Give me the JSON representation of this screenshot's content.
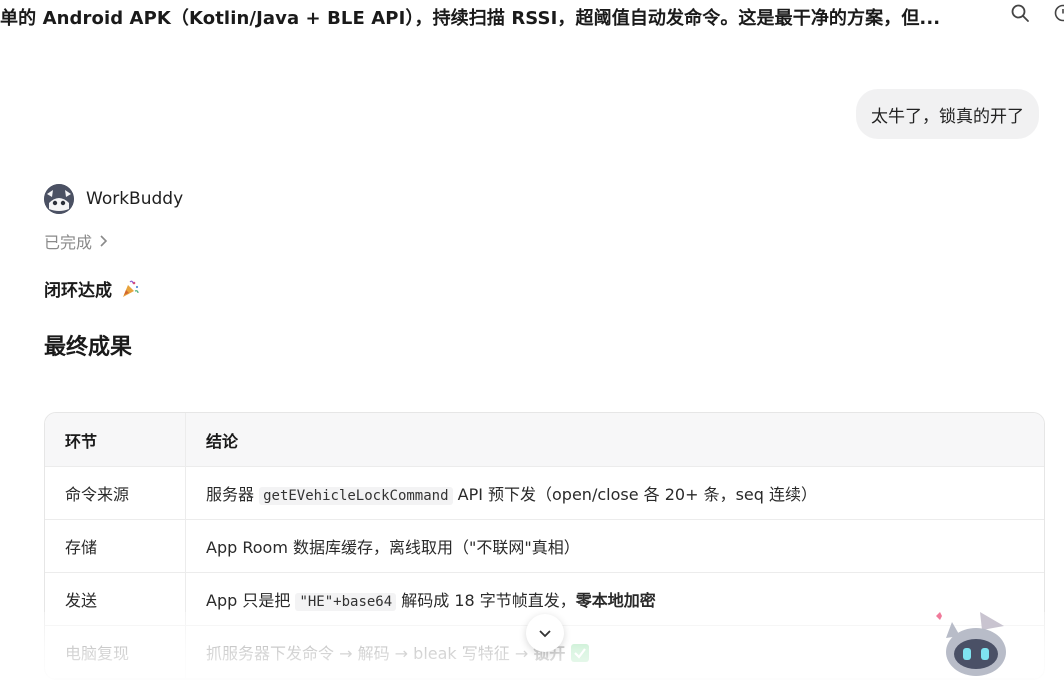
{
  "topbar": {
    "title": "单的 Android APK（Kotlin/Java + BLE API），持续扫描 RSSI，超阈值自动发命令。这是最干净的方案，但..."
  },
  "user_message": {
    "text": "太牛了，锁真的开了"
  },
  "assistant": {
    "name": "WorkBuddy",
    "status": "已完成",
    "subtitle": "闭环达成",
    "heading": "最终成果"
  },
  "table": {
    "headers": [
      "环节",
      "结论"
    ],
    "rows": [
      {
        "stage": "命令来源",
        "pre": "服务器 ",
        "code": "getEVehicleLockCommand",
        "post": " API 预下发（open/close 各 20+ 条，seq 连续）"
      },
      {
        "stage": "存储",
        "text": "App Room 数据库缓存，离线取用（\"不联网\"真相）"
      },
      {
        "stage": "发送",
        "pre": "App 只是把 ",
        "code": "\"HE\"+base64",
        "post": " 解码成 18 字节帧直发，",
        "bold": "零本地加密"
      },
      {
        "stage": "电脑复现",
        "pre": "抓服务器下发命令 → 解码 → bleak 写特征 → ",
        "bold": "锁开"
      }
    ]
  },
  "colors": {
    "bubble_bg": "#f1f1f2",
    "table_header_bg": "#f7f7f8",
    "check_green": "#5ad07a"
  },
  "icons": [
    "search-icon",
    "clock-icon",
    "chevron-right-icon",
    "party-popper-icon",
    "chevron-down-icon",
    "check-icon",
    "avatar"
  ]
}
